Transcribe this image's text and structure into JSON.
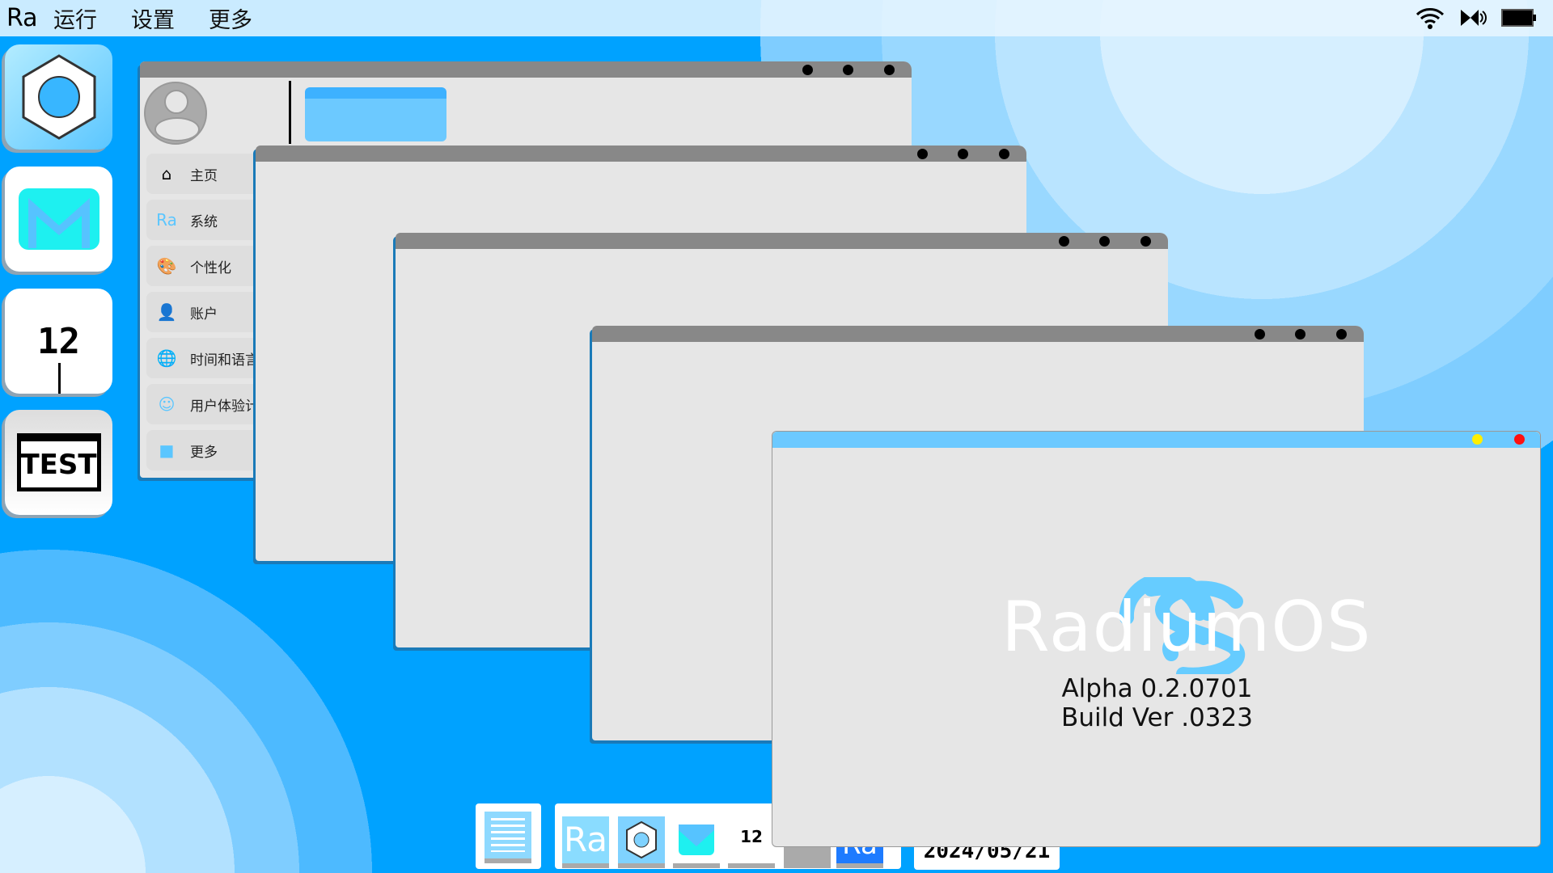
{
  "menubar": {
    "logo": "Ra",
    "items": [
      "运行",
      "设置",
      "更多"
    ],
    "tray_icons": [
      "wifi-icon",
      "volume-icon",
      "battery-icon"
    ]
  },
  "dock": [
    {
      "name": "settings-hexagon"
    },
    {
      "name": "mail"
    },
    {
      "name": "clock",
      "label": "12"
    },
    {
      "name": "test",
      "label": "TEST"
    }
  ],
  "settings_window": {
    "sidebar": [
      {
        "label": "主页",
        "icon": "home-icon"
      },
      {
        "label": "系统",
        "icon": "ra-icon"
      },
      {
        "label": "个性化",
        "icon": "palette-icon"
      },
      {
        "label": "账户",
        "icon": "user-icon"
      },
      {
        "label": "时间和语言",
        "icon": "globe-clock-icon"
      },
      {
        "label": "用户体验计划",
        "icon": "smile-icon"
      },
      {
        "label": "更多",
        "icon": "cube-icon"
      }
    ]
  },
  "about": {
    "logo_text": "RadiumOS",
    "version": "Alpha 0.2.0701",
    "build": "Build Ver .0323"
  },
  "taskbar": {
    "date": "2024/05/21",
    "clock_label": "12",
    "ra_label": "Ra"
  },
  "colors": {
    "desktop": "#00a2ff",
    "accent": "#6cc9ff",
    "titlebar": "#888888",
    "window": "#e6e6e6"
  }
}
